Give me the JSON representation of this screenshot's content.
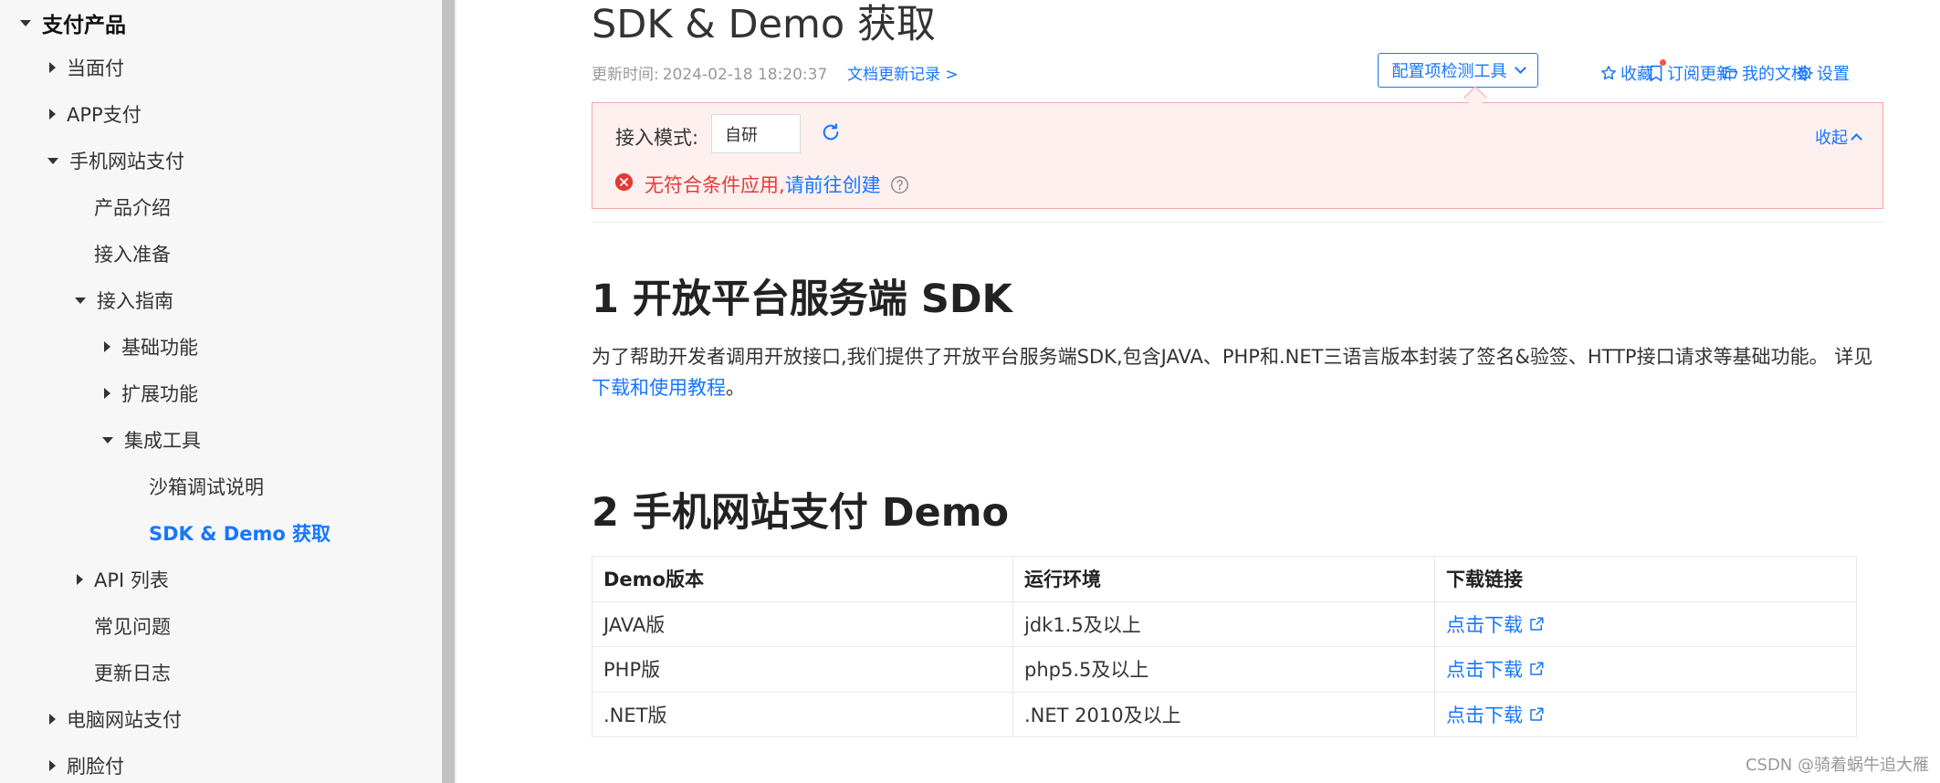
{
  "sidebar": {
    "items": [
      {
        "label": "支付产品"
      },
      {
        "label": "当面付"
      },
      {
        "label": "APP支付"
      },
      {
        "label": "手机网站支付"
      },
      {
        "label": "产品介绍"
      },
      {
        "label": "接入准备"
      },
      {
        "label": "接入指南"
      },
      {
        "label": "基础功能"
      },
      {
        "label": "扩展功能"
      },
      {
        "label": "集成工具"
      },
      {
        "label": "沙箱调试说明"
      },
      {
        "label": "SDK & Demo 获取"
      },
      {
        "label": "API 列表"
      },
      {
        "label": "常见问题"
      },
      {
        "label": "更新日志"
      },
      {
        "label": "电脑网站支付"
      },
      {
        "label": "刷脸付"
      }
    ]
  },
  "header": {
    "title": "SDK & Demo 获取",
    "updated_label": "更新时间:",
    "updated_time": "2024-02-18 18:20:37",
    "changelog_link": "文档更新记录 >",
    "config_tool": "配置项检测工具",
    "actions": {
      "favorite": "收藏",
      "subscribe": "订阅更新",
      "my_docs": "我的文档",
      "settings": "设置"
    }
  },
  "panel": {
    "mode_label": "接入模式:",
    "mode_value": "自研",
    "collapse": "收起",
    "error_text": "无符合条件应用,",
    "error_link": "请前往创建"
  },
  "section1": {
    "heading": "1 开放平台服务端 SDK",
    "para_text": "为了帮助开发者调用开放接口,我们提供了开放平台服务端SDK,包含JAVA、PHP和.NET三语言版本封装了签名&验签、HTTP接口请求等基础功能。 详见",
    "para_link": "下载和使用教程",
    "para_end": "。"
  },
  "section2": {
    "heading": "2 手机网站支付 Demo",
    "table": {
      "headers": [
        "Demo版本",
        "运行环境",
        "下载链接"
      ],
      "rows": [
        [
          "JAVA版",
          "jdk1.5及以上",
          "点击下载"
        ],
        [
          "PHP版",
          "php5.5及以上",
          "点击下载"
        ],
        [
          ".NET版",
          ".NET 2010及以上",
          "点击下载"
        ]
      ]
    }
  },
  "watermark": "CSDN @骑着蜗牛追大雁",
  "colors": {
    "accent": "#1677ff",
    "error": "#e53935",
    "panel_bg": "#fff0f0"
  }
}
